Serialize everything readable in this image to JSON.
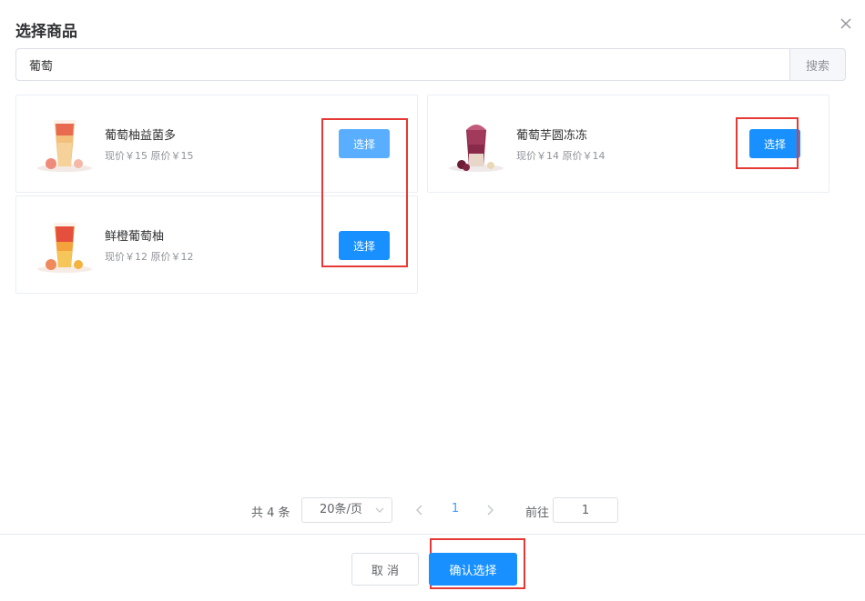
{
  "dialog": {
    "title": "选择商品",
    "close_icon": "close-icon"
  },
  "search": {
    "value": "葡萄",
    "button_label": "搜索"
  },
  "products": [
    {
      "name": "葡萄柚益菌多",
      "price": "现价￥15 原价￥15",
      "button_label": "选择",
      "thumb_icon": "grapefruit-drink-image"
    },
    {
      "name": "葡萄芋圆冻冻",
      "price": "现价￥14 原价￥14",
      "button_label": "选择",
      "thumb_icon": "grape-taro-drink-image"
    },
    {
      "name": "鲜橙葡萄柚",
      "price": "现价￥12 原价￥12",
      "button_label": "选择",
      "thumb_icon": "orange-grapefruit-drink-image"
    }
  ],
  "pagination": {
    "total": "共 4 条",
    "page_size": "20条/页",
    "current_page": "1",
    "goto_label": "前往",
    "goto_value": "1"
  },
  "footer": {
    "cancel_label": "取 消",
    "confirm_label": "确认选择"
  },
  "colors": {
    "primary": "#409eff",
    "button_blue": "#1890ff",
    "button_light": "#5aaeff",
    "annotation_red": "#e53935"
  }
}
